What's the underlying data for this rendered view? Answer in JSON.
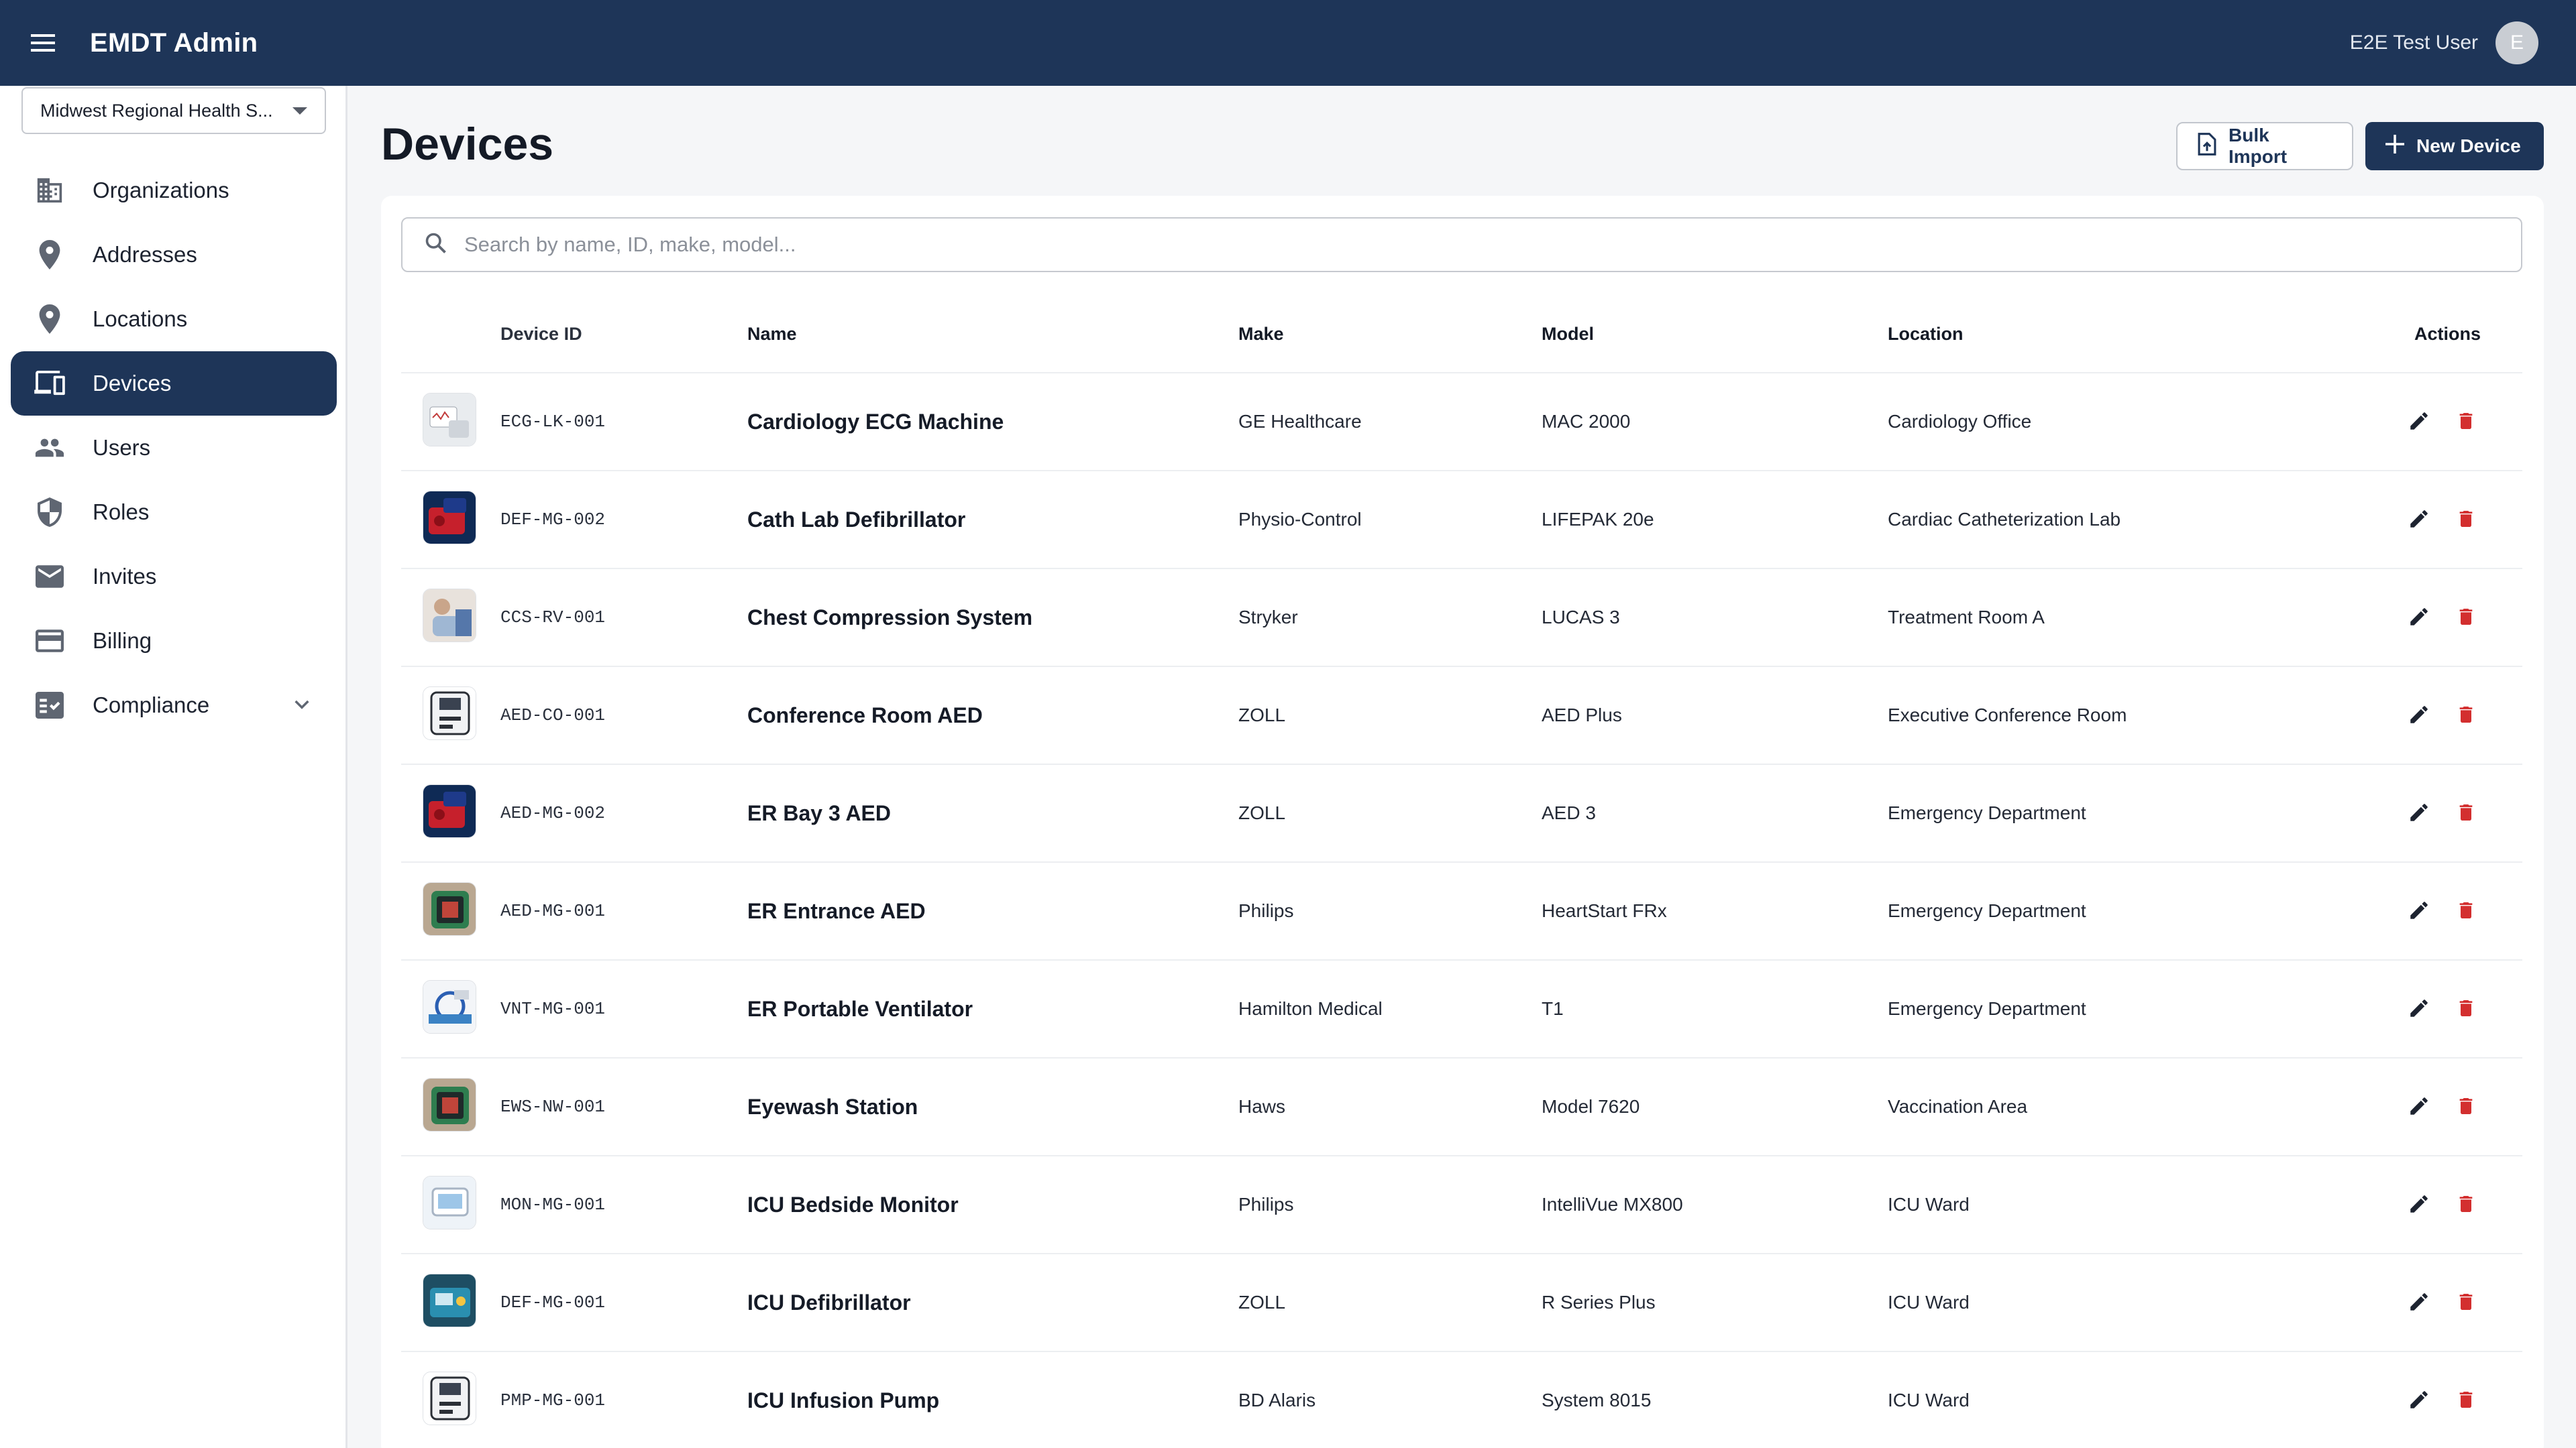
{
  "app": {
    "title": "EMDT Admin",
    "user_name": "E2E Test User",
    "avatar_initial": "E"
  },
  "org_selector": {
    "value": "Midwest Regional Health S..."
  },
  "sidebar": {
    "items": [
      {
        "label": "Organizations",
        "icon": "building-icon",
        "active": false
      },
      {
        "label": "Addresses",
        "icon": "map-pin-icon",
        "active": false
      },
      {
        "label": "Locations",
        "icon": "map-pin-icon",
        "active": false
      },
      {
        "label": "Devices",
        "icon": "devices-icon",
        "active": true
      },
      {
        "label": "Users",
        "icon": "users-icon",
        "active": false
      },
      {
        "label": "Roles",
        "icon": "shield-icon",
        "active": false
      },
      {
        "label": "Invites",
        "icon": "mail-icon",
        "active": false
      },
      {
        "label": "Billing",
        "icon": "credit-card-icon",
        "active": false
      },
      {
        "label": "Compliance",
        "icon": "checklist-icon",
        "active": false
      }
    ]
  },
  "page": {
    "title": "Devices",
    "bulk_import_label": "Bulk Import",
    "new_device_label": "New Device",
    "search_placeholder": "Search by name, ID, make, model..."
  },
  "table": {
    "headers": {
      "device_id": "Device ID",
      "name": "Name",
      "make": "Make",
      "model": "Model",
      "location": "Location",
      "actions": "Actions"
    },
    "rows": [
      {
        "device_id": "ECG-LK-001",
        "name": "Cardiology ECG Machine",
        "make": "GE Healthcare",
        "model": "MAC 2000",
        "location": "Cardiology Office",
        "thumb": "white"
      },
      {
        "device_id": "DEF-MG-002",
        "name": "Cath Lab Defibrillator",
        "make": "Physio-Control",
        "model": "LIFEPAK 20e",
        "location": "Cardiac Catheterization Lab",
        "thumb": "red"
      },
      {
        "device_id": "CCS-RV-001",
        "name": "Chest Compression System",
        "make": "Stryker",
        "model": "LUCAS 3",
        "location": "Treatment Room A",
        "thumb": "people"
      },
      {
        "device_id": "AED-CO-001",
        "name": "Conference Room AED",
        "make": "ZOLL",
        "model": "AED Plus",
        "location": "Executive Conference Room",
        "thumb": "aed"
      },
      {
        "device_id": "AED-MG-002",
        "name": "ER Bay 3 AED",
        "make": "ZOLL",
        "model": "AED 3",
        "location": "Emergency Department",
        "thumb": "red"
      },
      {
        "device_id": "AED-MG-001",
        "name": "ER Entrance AED",
        "make": "Philips",
        "model": "HeartStart FRx",
        "location": "Emergency Department",
        "thumb": "green"
      },
      {
        "device_id": "VNT-MG-001",
        "name": "ER Portable Ventilator",
        "make": "Hamilton Medical",
        "model": "T1",
        "location": "Emergency Department",
        "thumb": "blue"
      },
      {
        "device_id": "EWS-NW-001",
        "name": "Eyewash Station",
        "make": "Haws",
        "model": "Model 7620",
        "location": "Vaccination Area",
        "thumb": "green"
      },
      {
        "device_id": "MON-MG-001",
        "name": "ICU Bedside Monitor",
        "make": "Philips",
        "model": "IntelliVue MX800",
        "location": "ICU Ward",
        "thumb": "monitor"
      },
      {
        "device_id": "DEF-MG-001",
        "name": "ICU Defibrillator",
        "make": "ZOLL",
        "model": "R Series Plus",
        "location": "ICU Ward",
        "thumb": "teal"
      },
      {
        "device_id": "PMP-MG-001",
        "name": "ICU Infusion Pump",
        "make": "BD Alaris",
        "model": "System 8015",
        "location": "ICU Ward",
        "thumb": "aed"
      }
    ]
  },
  "colors": {
    "primary": "#1e3558",
    "delete": "#d32f2f",
    "edit": "#1d2330"
  }
}
